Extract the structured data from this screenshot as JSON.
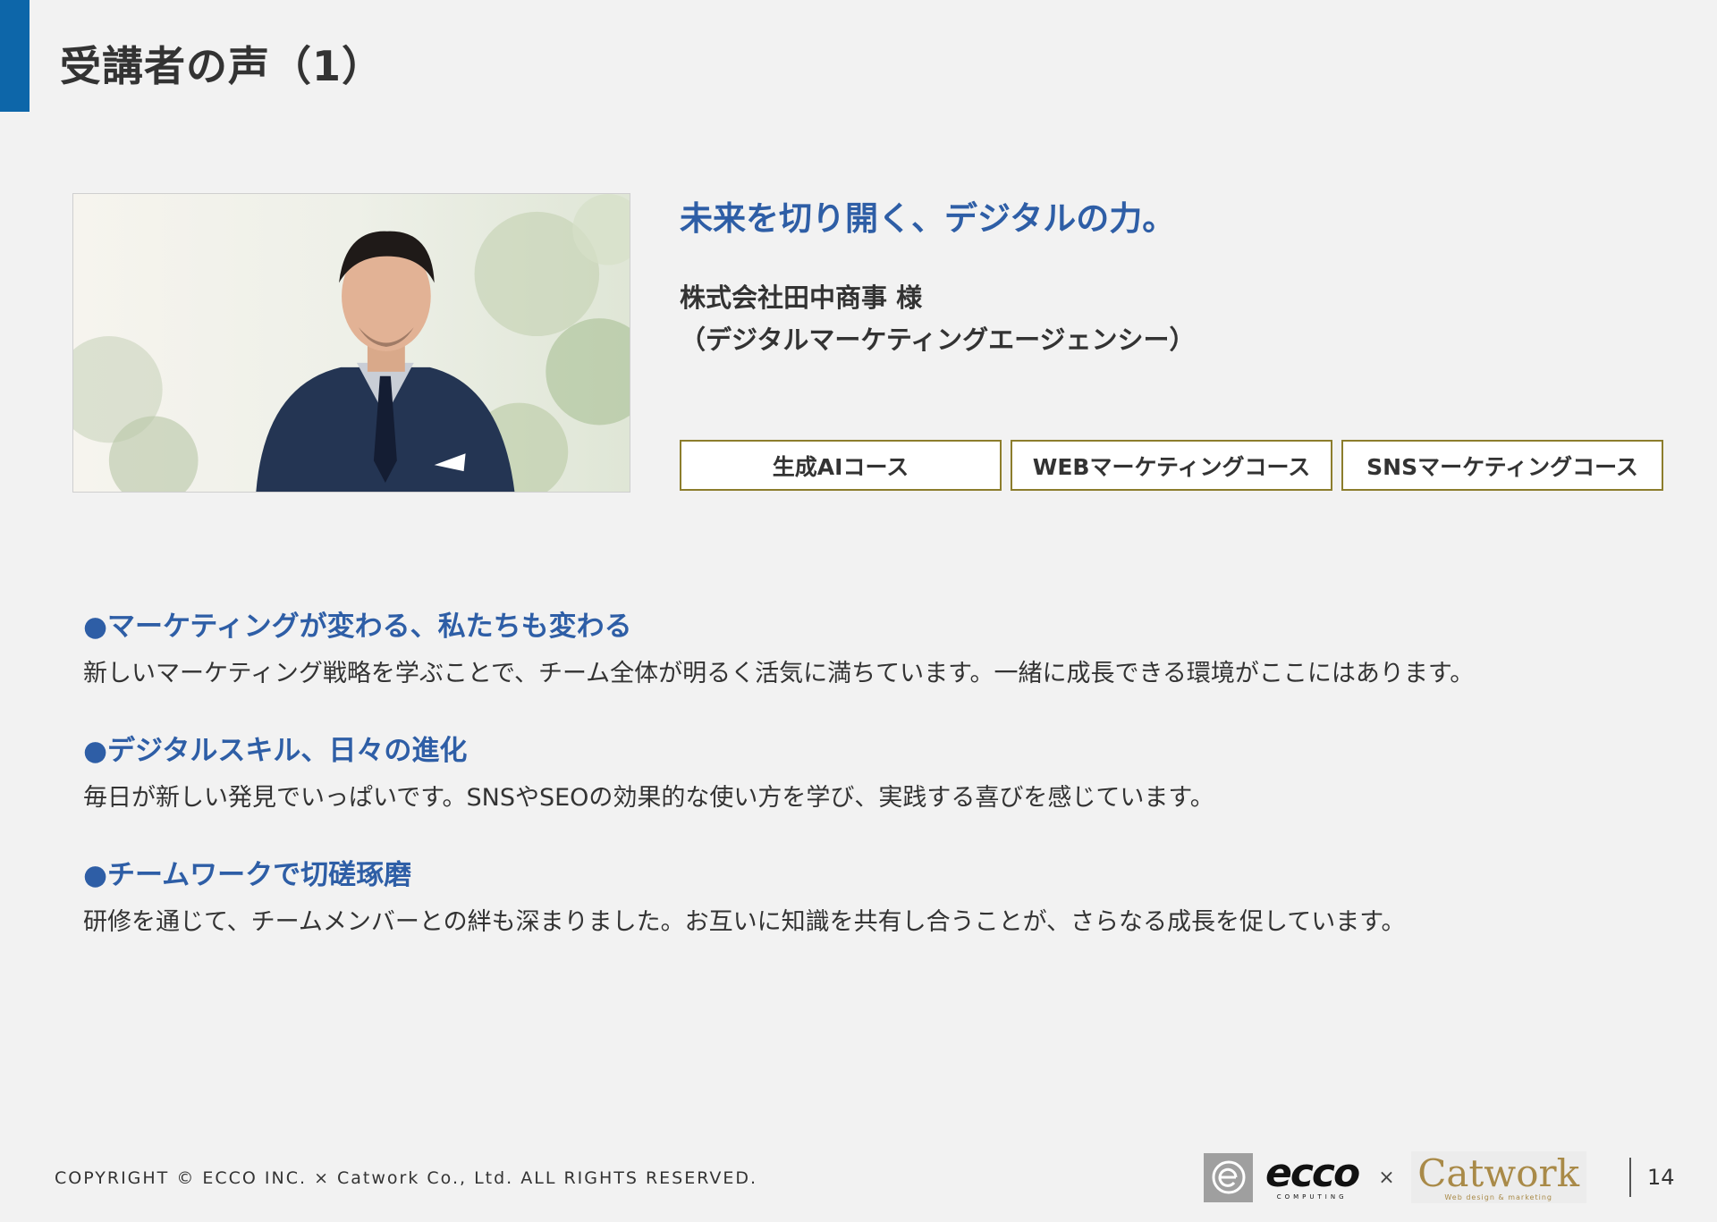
{
  "header": {
    "title": "受講者の声（1）",
    "accent_color": "#0d66a9"
  },
  "profile": {
    "photo_icon": "person-portrait-photo",
    "headline": "未来を切り開く、デジタルの力。",
    "company_name": "株式会社田中商事 様",
    "company_type": "（デジタルマーケティングエージェンシー）",
    "courses": [
      "生成AIコース",
      "WEBマーケティングコース",
      "SNSマーケティングコース"
    ],
    "headline_color": "#2e5ea6",
    "tag_border_color": "#8c7d2c"
  },
  "voices": [
    {
      "heading": "●マーケティングが変わる、私たちも変わる",
      "body": "新しいマーケティング戦略を学ぶことで、チーム全体が明るく活気に満ちています。一緒に成長できる環境がここにはあります。"
    },
    {
      "heading": "●デジタルスキル、日々の進化",
      "body": "毎日が新しい発見でいっぱいです。SNSやSEOの効果的な使い方を学び、実践する喜びを感じています。"
    },
    {
      "heading": "●チームワークで切磋琢磨",
      "body": "研修を通じて、チームメンバーとの絆も深まりました。お互いに知識を共有し合うことが、さらなる成長を促しています。"
    }
  ],
  "footer": {
    "copyright": "COPYRIGHT © ECCO INC. × Catwork Co., Ltd. ALL RIGHTS RESERVED.",
    "logo_ecco": "ecco",
    "logo_ecco_sub": "COMPUTING",
    "logo_times": "×",
    "logo_catwork": "Catwork",
    "logo_catwork_tag": "Web design & marketing",
    "page_number": "14"
  }
}
